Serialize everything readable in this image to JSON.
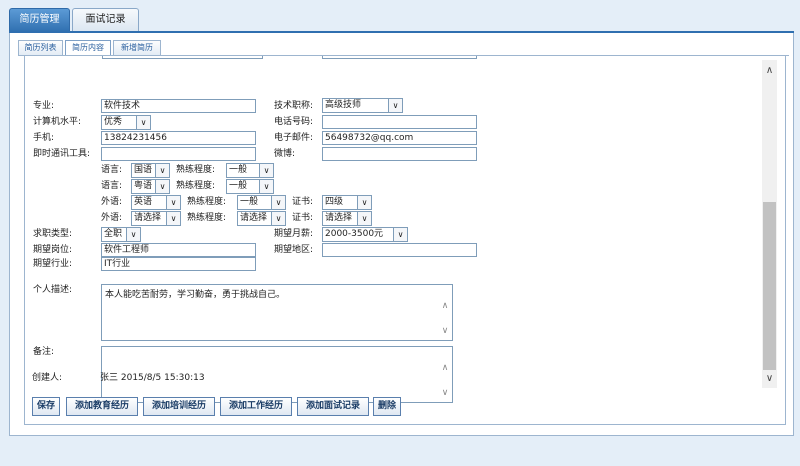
{
  "top_tabs": [
    {
      "label": "简历管理",
      "active": true
    },
    {
      "label": "面试记录",
      "active": false
    }
  ],
  "sub_tabs": [
    {
      "label": "简历列表",
      "active": false
    },
    {
      "label": "简历内容",
      "active": true
    },
    {
      "label": "新增简历",
      "active": false
    }
  ],
  "form": {
    "major_label": "专业:",
    "major_value": "软件技术",
    "title_label": "技术职称:",
    "title_value": "高级技师",
    "computer_label": "计算机水平:",
    "computer_value": "优秀",
    "phone_label": "电话号码:",
    "phone_value": "",
    "mobile_label": "手机:",
    "mobile_value": "13824231456",
    "email_label": "电子邮件:",
    "email_value": "56498732@qq.com",
    "im_label": "即时通讯工具:",
    "im_value": "",
    "weibo_label": "微博:",
    "weibo_value": "",
    "lang1_label": "语言:",
    "lang1_value": "国语",
    "lang1_prof_label": "熟练程度:",
    "lang1_prof_value": "一般",
    "lang2_label": "语言:",
    "lang2_value": "粤语",
    "lang2_prof_label": "熟练程度:",
    "lang2_prof_value": "一般",
    "foreign1_label": "外语:",
    "foreign1_value": "英语",
    "foreign1_prof_label": "熟练程度:",
    "foreign1_prof_value": "一般",
    "foreign1_cert_label": "证书:",
    "foreign1_cert_value": "四级",
    "foreign2_label": "外语:",
    "foreign2_value": "请选择",
    "foreign2_prof_label": "熟练程度:",
    "foreign2_prof_value": "请选择",
    "foreign2_cert_label": "证书:",
    "foreign2_cert_value": "请选择",
    "jobtype_label": "求职类型:",
    "jobtype_value": "全职",
    "salary_label": "期望月薪:",
    "salary_value": "2000-3500元",
    "position_label": "期望岗位:",
    "position_value": "软件工程师",
    "area_label": "期望地区:",
    "area_value": "",
    "industry_label": "期望行业:",
    "industry_value": "IT行业",
    "desc_label": "个人描述:",
    "desc_value": "本人能吃苦耐劳，学习勤奋，勇于挑战自己。",
    "remark_label": "备注:",
    "remark_value": "",
    "creator_label": "创建人:",
    "creator_value": "张三 2015/8/5 15:30:13"
  },
  "buttons": {
    "save": "保存",
    "add_education": "添加教育经历",
    "add_training": "添加培训经历",
    "add_work": "添加工作经历",
    "add_interview": "添加面试记录",
    "delete": "删除"
  },
  "icons": {
    "dropdown": "chevron-down-icon",
    "scroll_up": "arrow-up-icon",
    "scroll_down": "arrow-down-icon"
  },
  "colors": {
    "accent": "#2f6fb0",
    "border": "#7f9db9",
    "background": "#e4eef8"
  }
}
